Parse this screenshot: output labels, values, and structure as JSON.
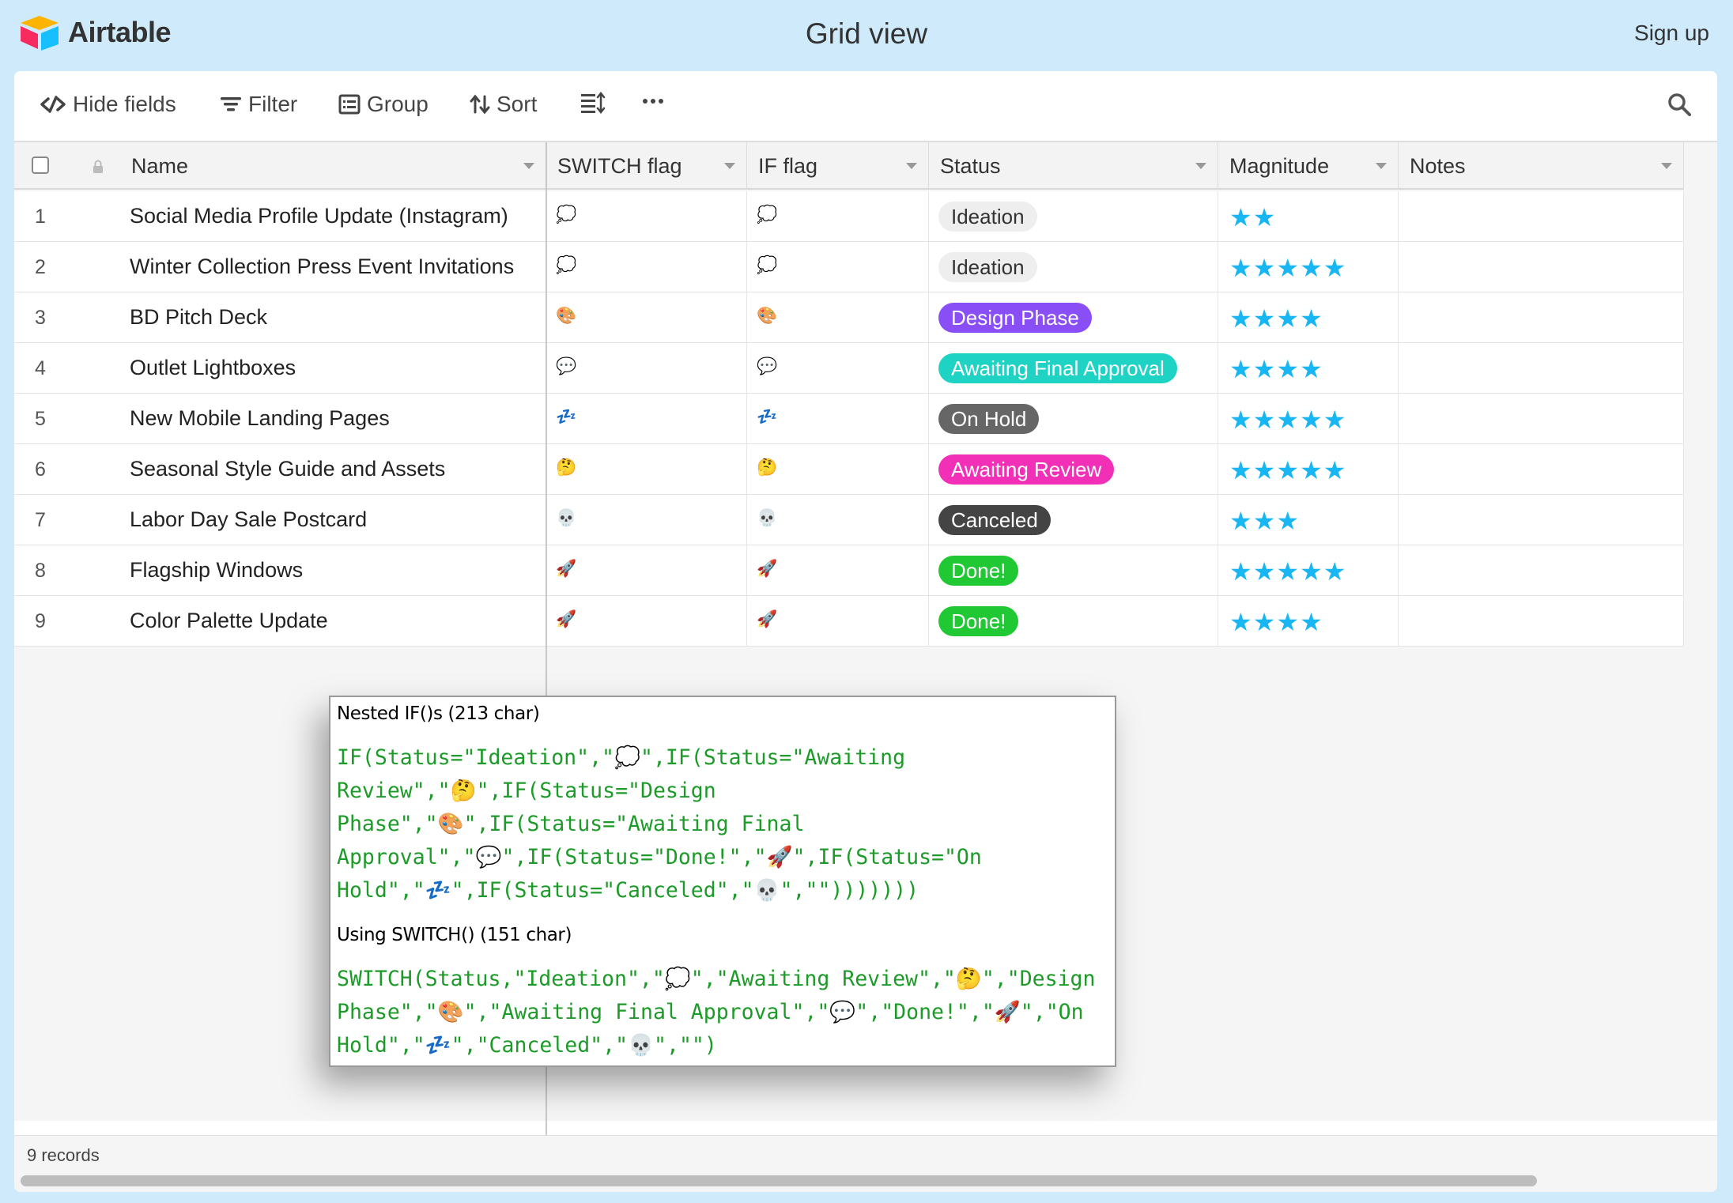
{
  "app": {
    "name": "Airtable",
    "page_title": "Grid view",
    "signup_label": "Sign up"
  },
  "toolbar": {
    "hide_fields": "Hide fields",
    "filter": "Filter",
    "group": "Group",
    "sort": "Sort"
  },
  "columns": {
    "name": "Name",
    "switch_flag": "SWITCH flag",
    "if_flag": "IF flag",
    "status": "Status",
    "magnitude": "Magnitude",
    "notes": "Notes"
  },
  "status_colors": {
    "Ideation": {
      "bg": "#eeeeee",
      "fg": "#333333"
    },
    "Design Phase": {
      "bg": "#8a4ef6",
      "fg": "#ffffff"
    },
    "Awaiting Final Approval": {
      "bg": "#1fd3c4",
      "fg": "#ffffff"
    },
    "On Hold": {
      "bg": "#666666",
      "fg": "#ffffff"
    },
    "Awaiting Review": {
      "bg": "#f22fb7",
      "fg": "#ffffff"
    },
    "Canceled": {
      "bg": "#444444",
      "fg": "#ffffff"
    },
    "Done!": {
      "bg": "#20c933",
      "fg": "#ffffff"
    }
  },
  "rows": [
    {
      "num": "1",
      "name": "Social Media Profile Update (Instagram)",
      "switch_flag": "💭",
      "if_flag": "💭",
      "status": "Ideation",
      "magnitude": 2
    },
    {
      "num": "2",
      "name": "Winter Collection Press Event Invitations",
      "switch_flag": "💭",
      "if_flag": "💭",
      "status": "Ideation",
      "magnitude": 5
    },
    {
      "num": "3",
      "name": "BD Pitch Deck",
      "switch_flag": "🎨",
      "if_flag": "🎨",
      "status": "Design Phase",
      "magnitude": 4
    },
    {
      "num": "4",
      "name": "Outlet Lightboxes",
      "switch_flag": "💬",
      "if_flag": "💬",
      "status": "Awaiting Final Approval",
      "magnitude": 4
    },
    {
      "num": "5",
      "name": "New Mobile Landing Pages",
      "switch_flag": "💤",
      "if_flag": "💤",
      "status": "On Hold",
      "magnitude": 5
    },
    {
      "num": "6",
      "name": "Seasonal Style Guide and Assets",
      "switch_flag": "🤔",
      "if_flag": "🤔",
      "status": "Awaiting Review",
      "magnitude": 5
    },
    {
      "num": "7",
      "name": "Labor Day Sale Postcard",
      "switch_flag": "💀",
      "if_flag": "💀",
      "status": "Canceled",
      "magnitude": 3
    },
    {
      "num": "8",
      "name": "Flagship Windows",
      "switch_flag": "🚀",
      "if_flag": "🚀",
      "status": "Done!",
      "magnitude": 5
    },
    {
      "num": "9",
      "name": "Color Palette Update",
      "switch_flag": "🚀",
      "if_flag": "🚀",
      "status": "Done!",
      "magnitude": 4
    }
  ],
  "footer": {
    "records": "9 records"
  },
  "popup": {
    "nested_title": "Nested IF()s (213 char)",
    "nested_code": "IF(Status=\"Ideation\",\"💭\",IF(Status=\"Awaiting Review\",\"🤔\",IF(Status=\"Design Phase\",\"🎨\",IF(Status=\"Awaiting Final Approval\",\"💬\",IF(Status=\"Done!\",\"🚀\",IF(Status=\"On Hold\",\"💤\",IF(Status=\"Canceled\",\"💀\",\"\")))))))",
    "switch_title": "Using SWITCH() (151 char)",
    "switch_code": "SWITCH(Status,\"Ideation\",\"💭\",\"Awaiting Review\",\"🤔\",\"Design Phase\",\"🎨\",\"Awaiting Final Approval\",\"💬\",\"Done!\",\"🚀\",\"On Hold\",\"💤\",\"Canceled\",\"💀\",\"\")"
  }
}
